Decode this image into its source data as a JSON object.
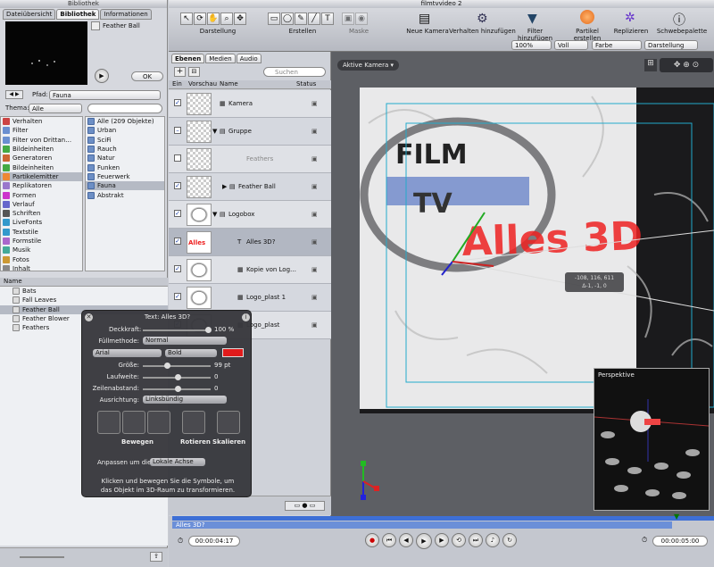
{
  "library": {
    "window_title": "Bibliothek",
    "tabs": [
      "Dateiübersicht",
      "Bibliothek",
      "Informationen"
    ],
    "preview_item": "Feather Ball",
    "ok_label": "OK",
    "path_label": "Pfad:",
    "path_value": "Fauna",
    "theme_label": "Thema:",
    "theme_value": "Alle",
    "search_placeholder": "",
    "categories": [
      "Verhalten",
      "Filter",
      "Filter von Drittan…",
      "Bildeinheiten",
      "Generatoren",
      "Bildeinheiten",
      "Partikelemitter",
      "Replikatoren",
      "Formen",
      "Verlauf",
      "Schriften",
      "LiveFonts",
      "Textstile",
      "Formstile",
      "Musik",
      "Fotos",
      "Inhalt"
    ],
    "subcategories": [
      "Alle (209 Objekte)",
      "Urban",
      "SciFi",
      "Rauch",
      "Natur",
      "Funken",
      "Feuerwerk",
      "Fauna",
      "Abstrakt"
    ],
    "list_header": "Name",
    "items": [
      "Bats",
      "Fall Leaves",
      "Feather Ball",
      "Feather Blower",
      "Feathers"
    ]
  },
  "toolbar": {
    "window_title": "filmtvvideo 2",
    "groups": [
      "Darstellung",
      "Erstellen",
      "Maske"
    ],
    "actions": [
      "Neue Kamera",
      "Verhalten hinzufügen",
      "Filter hinzufügen",
      "Partikel erstellen",
      "Replizieren",
      "Schwebepalette"
    ],
    "zoom": "100%",
    "resolution": "Voll",
    "color": "Farbe",
    "view": "Darstellung"
  },
  "layers": {
    "tabs": [
      "Ebenen",
      "Medien",
      "Audio"
    ],
    "search_placeholder": "Suchen",
    "columns": [
      "Ein",
      "Vorschau",
      "Name",
      "Status"
    ],
    "rows": [
      "Kamera",
      "Gruppe",
      "Feathers",
      "Feather Ball",
      "Logobox",
      "Alles 3D?",
      "Kopie von Log…",
      "Logo_plast 1",
      "Logo_plast"
    ]
  },
  "canvas": {
    "camera_menu": "Aktive Kamera",
    "overlay_text": "Alles 3D",
    "coord_readout": "-108, 116, 611",
    "coord_readout2": "Δ-1, -1, 0",
    "inset_title": "Perspektive"
  },
  "hud": {
    "title": "Text: Alles 3D?",
    "opacity_label": "Deckkraft:",
    "opacity_value": "100 %",
    "blend_label": "Füllmethode:",
    "blend_value": "Normal",
    "font_value": "Arial",
    "style_value": "Bold",
    "color": "#e11b1b",
    "size_label": "Größe:",
    "size_value": "99 pt",
    "tracking_label": "Laufweite:",
    "tracking_value": "0",
    "leading_label": "Zeilenabstand:",
    "leading_value": "0",
    "align_label": "Ausrichtung:",
    "align_value": "Linksbündig",
    "transform_labels": [
      "Bewegen",
      "Rotieren",
      "Skalieren"
    ],
    "adjust_label": "Anpassen um die:",
    "adjust_value": "Lokale Achse",
    "hint": "Klicken und bewegen Sie die Symbole, um das Objekt im 3D-Raum zu transformieren."
  },
  "timeline": {
    "track_label": "Alles 3D?",
    "current_time": "00:00:04:17",
    "end_time": "00:00:05:00"
  }
}
